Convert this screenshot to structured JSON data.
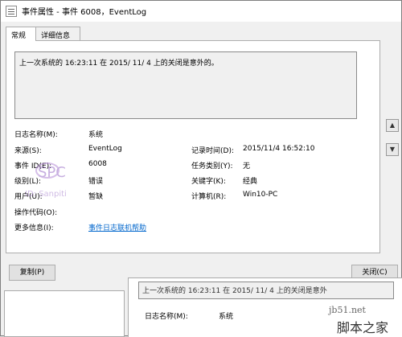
{
  "window": {
    "title": "事件属性 - 事件 6008，EventLog"
  },
  "tabs": [
    {
      "label": "常规"
    },
    {
      "label": "详细信息"
    }
  ],
  "description": "上一次系统的 16:23:11 在    2015/   11/   4 上的关闭是意外的。",
  "fields": {
    "log_name_label": "日志名称(M):",
    "log_name_value": "系统",
    "source_label": "来源(S):",
    "source_value": "EventLog",
    "logged_label": "记录时间(D):",
    "logged_value": "2015/11/4 16:52:10",
    "event_id_label": "事件 ID(E):",
    "event_id_value": "6008",
    "task_label": "任务类别(Y):",
    "task_value": "无",
    "level_label": "级别(L):",
    "level_value": "错误",
    "keywords_label": "关键字(K):",
    "keywords_value": "经典",
    "user_label": "用户(U):",
    "user_value": "暂缺",
    "computer_label": "计算机(R):",
    "computer_value": "Win10-PC",
    "opcode_label": "操作代码(O):",
    "more_info_label": "更多信息(I):",
    "more_info_link": "事件日志联机帮助"
  },
  "watermark": {
    "logo_text": "SPC",
    "line_text": "ID: Sanpiti"
  },
  "buttons": {
    "copy": "复制(P)",
    "close": "关闭(C)"
  },
  "background_window": {
    "description": "上一次系统的 16:23:11 在    2015/   11/   4 上的关闭是意外",
    "log_name_label": "日志名称(M):",
    "log_name_value": "系统"
  },
  "site_watermark": {
    "url": "jb51.net",
    "name": "脚本之家"
  },
  "icons": [
    "app-log-icon",
    "scroll-up-icon",
    "scroll-down-icon"
  ]
}
